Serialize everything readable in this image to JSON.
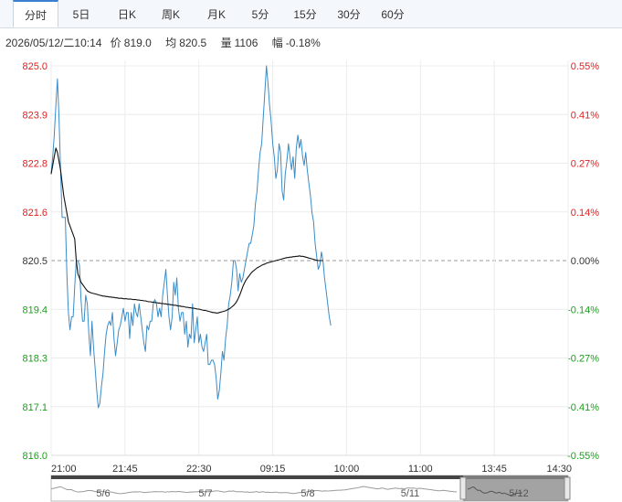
{
  "tabs": [
    {
      "label": "分时",
      "active": true
    },
    {
      "label": "5日"
    },
    {
      "label": "日K"
    },
    {
      "label": "周K"
    },
    {
      "label": "月K"
    },
    {
      "label": "5分"
    },
    {
      "label": "15分"
    },
    {
      "label": "30分"
    },
    {
      "label": "60分"
    }
  ],
  "info": {
    "datetime": "2026/05/12/二10:14",
    "price_label": "价",
    "price": "819.0",
    "avg_label": "均",
    "avg": "820.5",
    "volume_label": "量",
    "volume": "1106",
    "change_label": "幅",
    "change": "-0.18%"
  },
  "colors": {
    "up": "#e02020",
    "down": "#1aa01a",
    "neutral": "#333333",
    "price_line": "#3a8cc8",
    "avg_line": "#111111",
    "grid": "#ececec"
  },
  "chart_data": {
    "type": "line",
    "y_ticks": [
      "825.0",
      "823.9",
      "822.8",
      "821.6",
      "820.5",
      "819.4",
      "818.3",
      "817.1",
      "816.0"
    ],
    "pct_ticks": [
      "0.55%",
      "0.41%",
      "0.27%",
      "0.14%",
      "0.00%",
      "-0.14%",
      "-0.27%",
      "-0.41%",
      "-0.55%"
    ],
    "x_ticks": [
      "21:00",
      "21:45",
      "22:30",
      "09:15",
      "10:00",
      "11:00",
      "13:45",
      "14:30"
    ],
    "ylim": [
      816.0,
      825.0
    ],
    "prev_close": 820.5,
    "series": [
      {
        "name": "price",
        "values": [
          822.5,
          822.9,
          823.4,
          824.1,
          824.7,
          823.8,
          822.6,
          821.5,
          821.5,
          821.5,
          820.2,
          819.3,
          818.9,
          819.2,
          819.2,
          819.9,
          820.5,
          820.5,
          820.4,
          819.6,
          819.1,
          819.1,
          819.7,
          819.5,
          818.8,
          818.3,
          819.1,
          818.5,
          818.0,
          817.5,
          817.1,
          817.2,
          817.6,
          817.9,
          818.4,
          818.8,
          819.0,
          819.1,
          819.0,
          819.3,
          818.7,
          818.3,
          818.6,
          818.9,
          819.0,
          819.2,
          819.4,
          819.1,
          819.3,
          819.3,
          818.7,
          819.3,
          819.0,
          819.5,
          819.3,
          819.2,
          819.5,
          819.2,
          818.9,
          818.6,
          818.4,
          819.0,
          818.9,
          819.1,
          819.1,
          819.5,
          819.6,
          819.5,
          819.2,
          819.4,
          819.2,
          819.7,
          820.0,
          820.3,
          819.7,
          819.2,
          818.9,
          819.2,
          820.0,
          819.7,
          820.1,
          819.4,
          819.1,
          819.3,
          819.3,
          818.8,
          819.1,
          818.5,
          818.8,
          818.7,
          819.5,
          818.6,
          818.9,
          819.2,
          818.6,
          818.8,
          818.5,
          818.4,
          818.6,
          818.8,
          818.1,
          818.1,
          818.2,
          818.2,
          818.1,
          817.8,
          817.3,
          817.5,
          817.9,
          818.4,
          818.2,
          818.7,
          819.0,
          819.5,
          819.7,
          820.0,
          820.5,
          820.5,
          820.3,
          819.8,
          820.2,
          820.0,
          820.1,
          820.3,
          820.5,
          820.7,
          820.9,
          820.9,
          821.1,
          821.3,
          821.8,
          822.1,
          822.6,
          823.0,
          823.2,
          823.8,
          824.4,
          825.0,
          824.6,
          824.1,
          823.7,
          823.2,
          822.9,
          822.4,
          822.6,
          823.2,
          823.0,
          822.1,
          821.9,
          822.5,
          822.8,
          823.2,
          822.9,
          822.6,
          822.9,
          822.4,
          823.1,
          823.4,
          823.1,
          823.3,
          822.9,
          822.7,
          823.0,
          822.6,
          822.3,
          822.0,
          821.6,
          821.4,
          820.9,
          820.6,
          820.3,
          820.4,
          820.7,
          820.5,
          820.1,
          819.8,
          819.5,
          819.2,
          819.0
        ]
      },
      {
        "name": "avg",
        "values": [
          822.5,
          822.7,
          822.9,
          823.1,
          823.0,
          822.8,
          822.6,
          822.3,
          822.0,
          821.8,
          821.6,
          821.4,
          821.3,
          821.2,
          821.1,
          821.0,
          820.5,
          820.2,
          820.1,
          820.0,
          819.95,
          819.9,
          819.85,
          819.8,
          819.78,
          819.76,
          819.75,
          819.74,
          819.73,
          819.72,
          819.71,
          819.7,
          819.69,
          819.68,
          819.68,
          819.67,
          819.67,
          819.66,
          819.66,
          819.65,
          819.65,
          819.64,
          819.64,
          819.63,
          819.63,
          819.63,
          819.62,
          819.62,
          819.62,
          819.61,
          819.61,
          819.61,
          819.6,
          819.6,
          819.6,
          819.59,
          819.59,
          819.58,
          819.58,
          819.57,
          819.57,
          819.56,
          819.55,
          819.55,
          819.54,
          819.54,
          819.53,
          819.53,
          819.52,
          819.52,
          819.51,
          819.51,
          819.5,
          819.5,
          819.49,
          819.49,
          819.48,
          819.48,
          819.47,
          819.47,
          819.46,
          819.45,
          819.45,
          819.44,
          819.44,
          819.43,
          819.42,
          819.42,
          819.41,
          819.41,
          819.4,
          819.4,
          819.39,
          819.38,
          819.38,
          819.37,
          819.36,
          819.35,
          819.35,
          819.34,
          819.33,
          819.32,
          819.31,
          819.3,
          819.3,
          819.29,
          819.29,
          819.3,
          819.31,
          819.32,
          819.33,
          819.34,
          819.36,
          819.38,
          819.4,
          819.43,
          819.46,
          819.5,
          819.55,
          819.62,
          819.7,
          819.8,
          819.9,
          819.98,
          820.05,
          820.1,
          820.15,
          820.2,
          820.24,
          820.27,
          820.3,
          820.33,
          820.35,
          820.37,
          820.39,
          820.41,
          820.42,
          820.44,
          820.45,
          820.46,
          820.47,
          820.48,
          820.49,
          820.5,
          820.51,
          820.52,
          820.53,
          820.54,
          820.55,
          820.56,
          820.57,
          820.57,
          820.58,
          820.58,
          820.59,
          820.59,
          820.6,
          820.6,
          820.61,
          820.6,
          820.6,
          820.59,
          820.58,
          820.57,
          820.56,
          820.55,
          820.54,
          820.53,
          820.52,
          820.51,
          820.5,
          820.5,
          820.5,
          820.5
        ]
      }
    ],
    "total_points": 330,
    "nav_dates": [
      "5/6",
      "5/7",
      "5/8",
      "5/11",
      "5/12"
    ]
  }
}
